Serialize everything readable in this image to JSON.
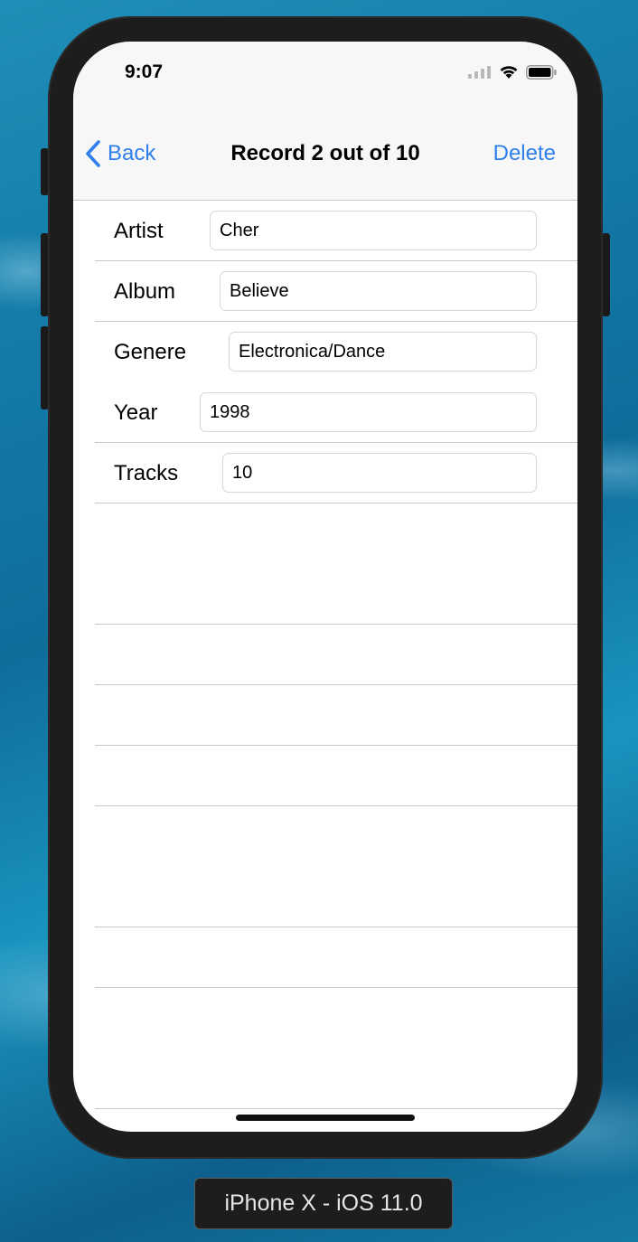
{
  "status_bar": {
    "time": "9:07",
    "icons": [
      "signal-icon",
      "wifi-icon",
      "battery-icon"
    ]
  },
  "nav": {
    "back_label": "Back",
    "title": "Record 2 out of 10",
    "delete_label": "Delete",
    "tint_color": "#2f80ed"
  },
  "fields": [
    {
      "label": "Artist",
      "value": "Cher"
    },
    {
      "label": "Album",
      "value": "Believe"
    },
    {
      "label": "Genere",
      "value": "Electronica/Dance"
    },
    {
      "label": "Year",
      "value": "1998"
    },
    {
      "label": "Tracks",
      "value": "10"
    }
  ],
  "device_caption": "iPhone X - iOS 11.0"
}
